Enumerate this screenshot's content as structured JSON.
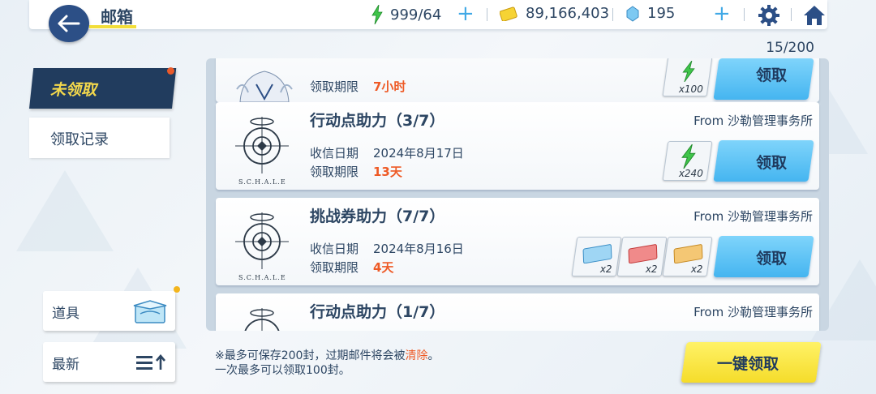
{
  "header": {
    "title": "邮箱",
    "ap": "999/64",
    "credits": "89,166,403",
    "gems": "195"
  },
  "mail_count": "15/200",
  "tabs": {
    "unclaimed": "未领取",
    "record": "领取记录"
  },
  "side": {
    "items_label": "道具",
    "sort_label": "最新"
  },
  "labels": {
    "received_date": "收信日期",
    "deadline": "领取期限",
    "claim": "领取"
  },
  "mails": [
    {
      "deadline": "7小时",
      "reward_qty": "x100",
      "claim_label": "领取"
    },
    {
      "title": "行动点助力（3/7）",
      "from": "From 沙勒管理事务所",
      "date": "2024年8月17日",
      "deadline": "13天",
      "reward_qty": "x240",
      "seal": "S.C.H.A.L.E"
    },
    {
      "title": "挑战券助力（7/7）",
      "from": "From 沙勒管理事务所",
      "date": "2024年8月16日",
      "deadline": "4天",
      "rewards": [
        "x2",
        "x2",
        "x2"
      ],
      "seal": "S.C.H.A.L.E"
    },
    {
      "title": "行动点助力（1/7）",
      "from": "From 沙勒管理事务所"
    }
  ],
  "footer": {
    "note_line1_a": "※最多可保存200封，过期邮件将会被",
    "note_line1_b": "清除",
    "note_line1_c": "。",
    "note_line2": "一次最多可以领取100封。",
    "claim_all": "一键领取"
  },
  "colors": {
    "navy": "#213c5e",
    "accent_yellow": "#f3d84c",
    "claim_blue": "#45b5f0",
    "deadline_red": "#ee5a26"
  }
}
